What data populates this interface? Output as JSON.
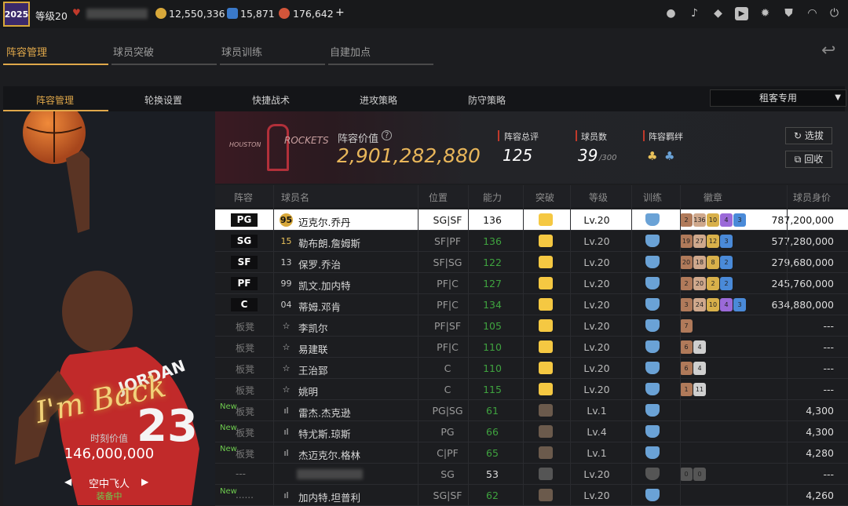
{
  "topbar": {
    "logo": "2025",
    "level": "等级20",
    "coins": "12,550,336",
    "stars": "15,871",
    "diamonds": "176,642",
    "plus": "+"
  },
  "tabs1": [
    "阵容管理",
    "球员突破",
    "球员训练",
    "自建加点"
  ],
  "tabs2": [
    "阵容管理",
    "轮换设置",
    "快捷战术",
    "进攻策略",
    "防守策略"
  ],
  "dropdown": "租客专用",
  "left": {
    "signature": "I'm Back",
    "value_label": "时刻价值",
    "value": "146,000,000",
    "player_name": "空中飞人",
    "status": "装备中",
    "jersey_text": "JORDAN",
    "jersey_number": "23"
  },
  "team": {
    "logo_text": "ROCKETS",
    "logo_small": "HOUSTON",
    "value_label": "阵容价值",
    "value": "2,901,282,880",
    "rating_label": "阵容总评",
    "rating": "125",
    "count_label": "球员数",
    "count": "39",
    "count_max": "/300",
    "bond_label": "阵容羁绊",
    "btn_pick": "选拔",
    "btn_recall": "回收"
  },
  "columns": [
    "阵容",
    "球员名",
    "位置",
    "能力",
    "突破",
    "等级",
    "训练",
    "徽章",
    "球员身价"
  ],
  "rows": [
    {
      "slot": "PG",
      "bench": false,
      "new": false,
      "num": "95",
      "name": "迈克尔.乔丹",
      "pos": "SG|SF",
      "ovr": "136",
      "ovrColor": "#111",
      "crown": "gold",
      "lv": "Lv.20",
      "badges": [
        [
          "2",
          "#b07a5a"
        ],
        [
          "136",
          "#cfa88c"
        ],
        [
          "10",
          "#d8b04a"
        ],
        [
          "4",
          "#9b6ad8"
        ],
        [
          "3",
          "#4a8ad8"
        ]
      ],
      "value": "787,200,000"
    },
    {
      "slot": "SG",
      "bench": false,
      "new": false,
      "num": "15",
      "name": "勒布朗.詹姆斯",
      "pos": "SF|PF",
      "ovr": "136",
      "ovrColor": "#3fa33f",
      "crown": "gold",
      "lv": "Lv.20",
      "badges": [
        [
          "19",
          "#b07a5a"
        ],
        [
          "27",
          "#cfa88c"
        ],
        [
          "12",
          "#d8b04a"
        ],
        [
          "3",
          "#4a8ad8"
        ]
      ],
      "value": "577,280,000"
    },
    {
      "slot": "SF",
      "bench": false,
      "new": false,
      "num": "13",
      "name": "保罗.乔治",
      "pos": "SF|SG",
      "ovr": "122",
      "ovrColor": "#3fa33f",
      "crown": "gold",
      "lv": "Lv.20",
      "badges": [
        [
          "20",
          "#b07a5a"
        ],
        [
          "18",
          "#cfa88c"
        ],
        [
          "8",
          "#d8b04a"
        ],
        [
          "2",
          "#4a8ad8"
        ]
      ],
      "value": "279,680,000"
    },
    {
      "slot": "PF",
      "bench": false,
      "new": false,
      "num": "99",
      "name": "凯文.加内特",
      "pos": "PF|C",
      "ovr": "127",
      "ovrColor": "#3fa33f",
      "crown": "gold",
      "lv": "Lv.20",
      "badges": [
        [
          "2",
          "#b07a5a"
        ],
        [
          "20",
          "#cfa88c"
        ],
        [
          "2",
          "#d8b04a"
        ],
        [
          "2",
          "#4a8ad8"
        ]
      ],
      "value": "245,760,000"
    },
    {
      "slot": "C",
      "bench": false,
      "new": false,
      "num": "04",
      "name": "蒂姆.邓肯",
      "pos": "PF|C",
      "ovr": "134",
      "ovrColor": "#3fa33f",
      "crown": "gold",
      "lv": "Lv.20",
      "badges": [
        [
          "3",
          "#b07a5a"
        ],
        [
          "24",
          "#cfa88c"
        ],
        [
          "10",
          "#d8b04a"
        ],
        [
          "4",
          "#9b6ad8"
        ],
        [
          "3",
          "#4a8ad8"
        ]
      ],
      "value": "634,880,000"
    },
    {
      "slot": "板凳",
      "bench": true,
      "new": false,
      "num": "☆",
      "name": "李凯尔",
      "pos": "PF|SF",
      "ovr": "105",
      "ovrColor": "#3fa33f",
      "crown": "gold",
      "lv": "Lv.20",
      "badges": [
        [
          "7",
          "#b07a5a"
        ]
      ],
      "value": "---"
    },
    {
      "slot": "板凳",
      "bench": true,
      "new": false,
      "num": "☆",
      "name": "易建联",
      "pos": "PF|C",
      "ovr": "110",
      "ovrColor": "#3fa33f",
      "crown": "gold",
      "lv": "Lv.20",
      "badges": [
        [
          "6",
          "#b07a5a"
        ],
        [
          "4",
          "#cfcfcf"
        ]
      ],
      "value": "---"
    },
    {
      "slot": "板凳",
      "bench": true,
      "new": false,
      "num": "☆",
      "name": "王治郅",
      "pos": "C",
      "ovr": "110",
      "ovrColor": "#3fa33f",
      "crown": "gold",
      "lv": "Lv.20",
      "badges": [
        [
          "6",
          "#b07a5a"
        ],
        [
          "4",
          "#cfcfcf"
        ]
      ],
      "value": "---"
    },
    {
      "slot": "板凳",
      "bench": true,
      "new": false,
      "num": "☆",
      "name": "姚明",
      "pos": "C",
      "ovr": "115",
      "ovrColor": "#3fa33f",
      "crown": "gold",
      "lv": "Lv.20",
      "badges": [
        [
          "1",
          "#b07a5a"
        ],
        [
          "11",
          "#cfcfcf"
        ]
      ],
      "value": "---"
    },
    {
      "slot": "板凳",
      "bench": true,
      "new": true,
      "num": "ıl",
      "name": "雷杰.杰克逊",
      "pos": "PG|SG",
      "ovr": "61",
      "ovrColor": "#3fa33f",
      "crown": "shield",
      "lv": "Lv.1",
      "badges": [],
      "value": "4,300"
    },
    {
      "slot": "板凳",
      "bench": true,
      "new": true,
      "num": "ıl",
      "name": "特尤斯.琼斯",
      "pos": "PG",
      "ovr": "66",
      "ovrColor": "#3fa33f",
      "crown": "shield",
      "lv": "Lv.4",
      "badges": [],
      "value": "4,300"
    },
    {
      "slot": "板凳",
      "bench": true,
      "new": true,
      "num": "ıl",
      "name": "杰迈克尔.格林",
      "pos": "C|PF",
      "ovr": "65",
      "ovrColor": "#3fa33f",
      "crown": "shield",
      "lv": "Lv.1",
      "badges": [],
      "value": "4,280"
    },
    {
      "slot": "---",
      "bench": true,
      "new": false,
      "num": "",
      "name": "",
      "pos": "SG",
      "ovr": "53",
      "ovrColor": "#ddd",
      "crown": "grey",
      "lv": "Lv.20",
      "badges": [
        [
          "0",
          "#555"
        ],
        [
          "0",
          "#555"
        ]
      ],
      "value": "---"
    },
    {
      "slot": "......",
      "bench": true,
      "new": true,
      "num": "ıl",
      "name": "加内特.坦普利",
      "pos": "SG|SF",
      "ovr": "62",
      "ovrColor": "#3fa33f",
      "crown": "shield",
      "lv": "Lv.20",
      "badges": [],
      "value": "4,260"
    }
  ]
}
